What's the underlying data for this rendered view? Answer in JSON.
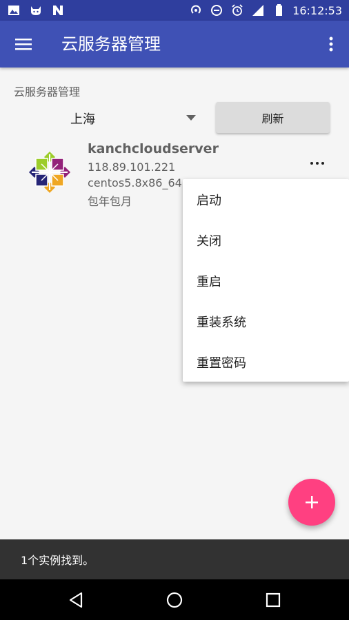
{
  "status_bar": {
    "time": "16:12:53",
    "left_icons": [
      "image-icon",
      "cat-notification-icon",
      "n-notification-icon"
    ],
    "right_icons": [
      "hotspot-icon",
      "data-saver-icon",
      "alarm-icon",
      "signal-icon",
      "battery-icon"
    ]
  },
  "app_bar": {
    "title": "云服务器管理"
  },
  "content": {
    "section_label": "云服务器管理",
    "region": "上海",
    "refresh_label": "刷新"
  },
  "server": {
    "name": "kanchcloudserver",
    "ip": "118.89.101.221",
    "os": "centos5.8x86_64",
    "billing": "包年包月"
  },
  "popup_menu": {
    "items": [
      "启动",
      "关闭",
      "重启",
      "重装系统",
      "重置密码"
    ]
  },
  "snackbar": {
    "message": "1个实例找到。"
  },
  "colors": {
    "status_bar": "#2f3e9e",
    "primary": "#3f51b5",
    "accent": "#ff4081",
    "snackbar": "#323232"
  }
}
